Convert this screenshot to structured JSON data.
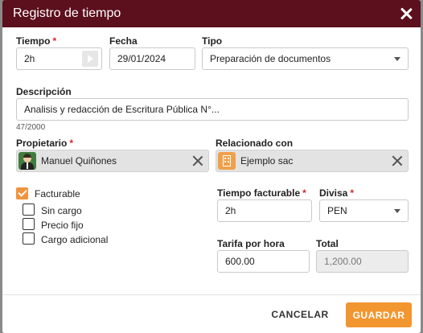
{
  "dialog": {
    "title": "Registro de tiempo"
  },
  "form": {
    "tiempo": {
      "label": "Tiempo",
      "required_mark": "*",
      "value": "2h"
    },
    "fecha": {
      "label": "Fecha",
      "value": "29/01/2024"
    },
    "tipo": {
      "label": "Tipo",
      "value": "Preparación de documentos"
    },
    "descripcion": {
      "label": "Descripción",
      "value": "Analisis y redacción de Escritura Pública N°...",
      "counter": "47/2000"
    },
    "propietario": {
      "label": "Propietario",
      "required_mark": "*",
      "value": "Manuel Quiñones"
    },
    "relacionado": {
      "label": "Relacionado con",
      "value": "Ejemplo sac"
    },
    "facturable": {
      "label": "Facturable",
      "checked": true
    },
    "options": [
      {
        "label": "Sin cargo",
        "checked": false
      },
      {
        "label": "Precio fijo",
        "checked": false
      },
      {
        "label": "Cargo adicional",
        "checked": false
      }
    ],
    "tiempo_facturable": {
      "label": "Tiempo facturable",
      "required_mark": "*",
      "value": "2h"
    },
    "divisa": {
      "label": "Divisa",
      "required_mark": "*",
      "value": "PEN"
    },
    "tarifa": {
      "label": "Tarifa por hora",
      "value": "600.00"
    },
    "total": {
      "label": "Total",
      "value": "1,200.00"
    }
  },
  "footer": {
    "cancel_label": "CANCELAR",
    "save_label": "GUARDAR"
  },
  "colors": {
    "header_bg": "#5c0f1c",
    "accent": "#f2962f",
    "required": "#d9232e"
  }
}
